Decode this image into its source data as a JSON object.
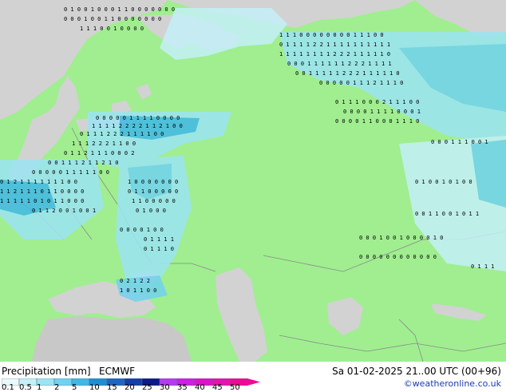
{
  "legend": {
    "title": "Precipitation [mm]",
    "model": "ECMWF",
    "ticks": [
      "0.1",
      "0.5",
      "1",
      "2",
      "5",
      "10",
      "15",
      "20",
      "25",
      "30",
      "35",
      "40",
      "45",
      "50"
    ],
    "colors": [
      "#e8f8fc",
      "#c4f0f8",
      "#9ce4f4",
      "#70d2ef",
      "#40b8e6",
      "#1f8fd4",
      "#1e66c2",
      "#143ea8",
      "#0c1a8c",
      "#b43cf0",
      "#cc1ee6",
      "#dc14c8",
      "#e812ae",
      "#f00a96"
    ]
  },
  "valid_time": "Sa 01-02-2025 21..00 UTC (00+96)",
  "credit": "©weatheronline.co.uk",
  "map": {
    "land_color": "#a0ee90",
    "sea_color": "#d2d2d2",
    "border_color": "#8a8a8a"
  }
}
